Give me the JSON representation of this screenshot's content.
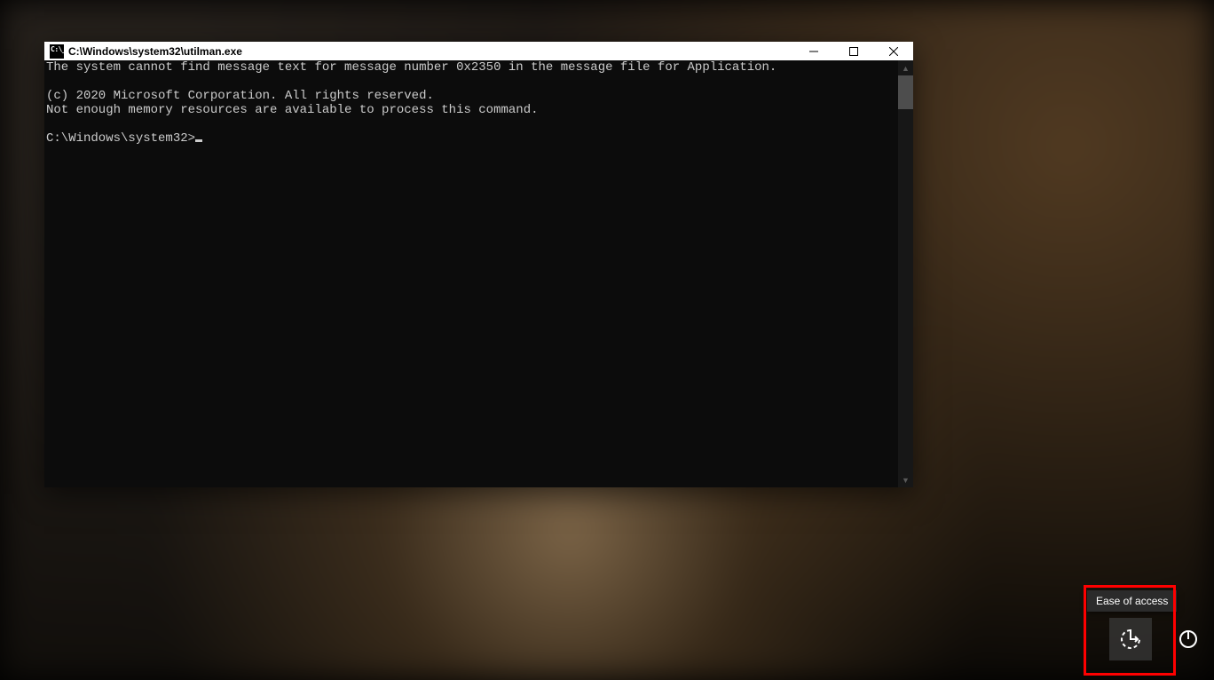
{
  "window": {
    "title": "C:\\Windows\\system32\\utilman.exe",
    "lines": {
      "l1": "The system cannot find message text for message number 0x2350 in the message file for Application.",
      "l2": "",
      "l3": "(c) 2020 Microsoft Corporation. All rights reserved.",
      "l4": "Not enough memory resources are available to process this command.",
      "l5": "",
      "prompt": "C:\\Windows\\system32>"
    }
  },
  "lockscreen": {
    "ease_tooltip": "Ease of access"
  }
}
